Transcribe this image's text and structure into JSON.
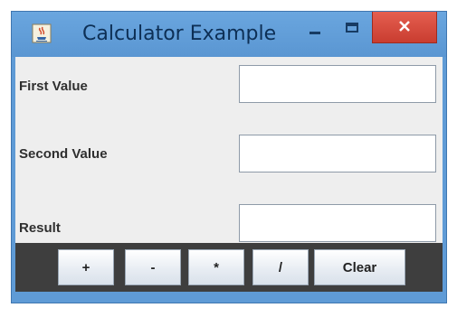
{
  "window": {
    "title": "Calculator Example",
    "app_icon": "java-cup-icon",
    "controls": {
      "minimize": "minimize-icon",
      "maximize": "maximize-icon",
      "close": "close-icon"
    }
  },
  "form": {
    "first_value_label": "First Value",
    "first_value": "",
    "second_value_label": "Second Value",
    "second_value": "",
    "result_label": "Result",
    "result_value": ""
  },
  "buttons": {
    "add_label": "+",
    "subtract_label": "-",
    "multiply_label": "*",
    "divide_label": "/",
    "clear_label": "Clear"
  },
  "colors": {
    "title_bar": "#5f9bd6",
    "close_button": "#d84a3c",
    "content_background": "#eeeeee",
    "button_bar": "#3e3e3e"
  }
}
